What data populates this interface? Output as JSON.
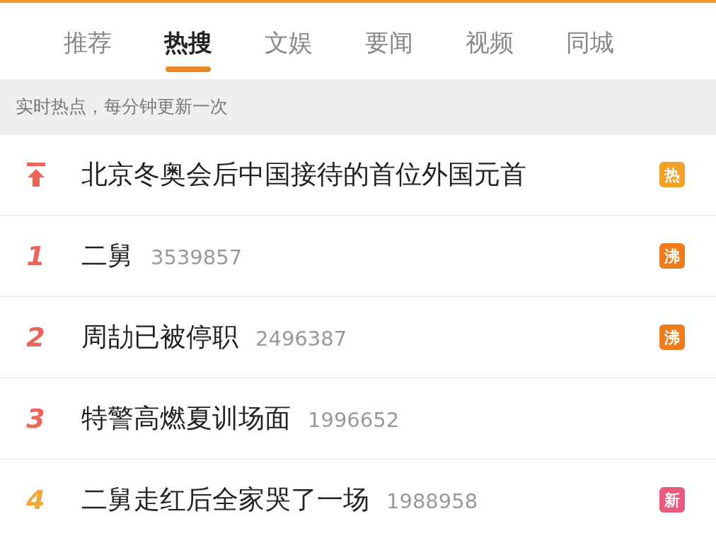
{
  "tabs": [
    {
      "label": "推荐",
      "selected": false
    },
    {
      "label": "热搜",
      "selected": true
    },
    {
      "label": "文娱",
      "selected": false
    },
    {
      "label": "要闻",
      "selected": false
    },
    {
      "label": "视频",
      "selected": false
    },
    {
      "label": "同城",
      "selected": false
    }
  ],
  "notice": "实时热点，每分钟更新一次",
  "rows": [
    {
      "kind": "pinned",
      "title": "北京冬奥会后中国接待的首位外国元首",
      "badge": {
        "text": "热",
        "color": "#f2a027"
      }
    },
    {
      "kind": "ranked",
      "rank": "1",
      "color": "#e8675a",
      "title": "二舅",
      "count": "3539857",
      "badge": {
        "text": "沸",
        "color": "#ee7b1c"
      }
    },
    {
      "kind": "ranked",
      "rank": "2",
      "color": "#e8675a",
      "title": "周劼已被停职",
      "count": "2496387",
      "badge": {
        "text": "沸",
        "color": "#ee7b1c"
      }
    },
    {
      "kind": "ranked",
      "rank": "3",
      "color": "#e8675a",
      "title": "特警高燃夏训场面",
      "count": "1996652"
    },
    {
      "kind": "ranked",
      "rank": "4",
      "color": "#f0a83a",
      "title": "二舅走红后全家哭了一场",
      "count": "1988958",
      "badge": {
        "text": "新",
        "color": "#e85a7e"
      }
    }
  ]
}
